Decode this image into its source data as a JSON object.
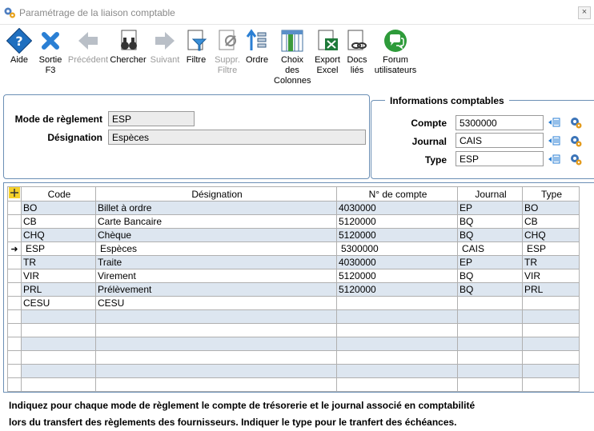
{
  "window": {
    "title": "Paramétrage de la liaison comptable",
    "close_label": "×"
  },
  "toolbar": {
    "aide": "Aide",
    "sortie": "Sortie F3",
    "precedent": "Précédent",
    "chercher": "Chercher",
    "suivant": "Suivant",
    "filtre": "Filtre",
    "suppr_filtre": "Suppr. Filtre",
    "ordre": "Ordre",
    "choix_colonnes": "Choix des Colonnes",
    "export_excel": "Export Excel",
    "docs_lies": "Docs liés",
    "forum": "Forum utilisateurs"
  },
  "form": {
    "mode_label": "Mode de règlement",
    "mode_value": "ESP",
    "designation_label": "Désignation",
    "designation_value": "Espèces"
  },
  "info": {
    "legend": "Informations comptables",
    "compte_label": "Compte",
    "compte_value": "5300000",
    "journal_label": "Journal",
    "journal_value": "CAIS",
    "type_label": "Type",
    "type_value": "ESP"
  },
  "table": {
    "columns": [
      "Code",
      "Désignation",
      "N° de compte",
      "Journal",
      "Type"
    ],
    "rows": [
      [
        "BO",
        "Billet à ordre",
        "4030000",
        "EP",
        "BO"
      ],
      [
        "CB",
        "Carte Bancaire",
        "5120000",
        "BQ",
        "CB"
      ],
      [
        "CHQ",
        "Chèque",
        "5120000",
        "BQ",
        "CHQ"
      ],
      [
        "ESP",
        "Espèces",
        "5300000",
        "CAIS",
        "ESP"
      ],
      [
        "TR",
        "Traite",
        "4030000",
        "EP",
        "TR"
      ],
      [
        "VIR",
        "Virement",
        "5120000",
        "BQ",
        "VIR"
      ],
      [
        "PRL",
        "Prélèvement",
        "5120000",
        "BQ",
        "PRL"
      ],
      [
        "CESU",
        "CESU",
        "",
        "",
        ""
      ],
      [
        "",
        "",
        "",
        "",
        ""
      ],
      [
        "",
        "",
        "",
        "",
        ""
      ],
      [
        "",
        "",
        "",
        "",
        ""
      ],
      [
        "",
        "",
        "",
        "",
        ""
      ],
      [
        "",
        "",
        "",
        "",
        ""
      ],
      [
        "",
        "",
        "",
        "",
        ""
      ]
    ],
    "current_row_marker": "➜"
  },
  "footer": {
    "line1": "Indiquez pour chaque mode de règlement le compte de trésorerie et le journal associé en comptabilité",
    "line2": "lors du transfert des règlements des fournisseurs.  Indiquer le type pour le tranfert des échéances."
  },
  "colors": {
    "accent": "#6b8fb5",
    "row_alt": "#dde6f0"
  }
}
